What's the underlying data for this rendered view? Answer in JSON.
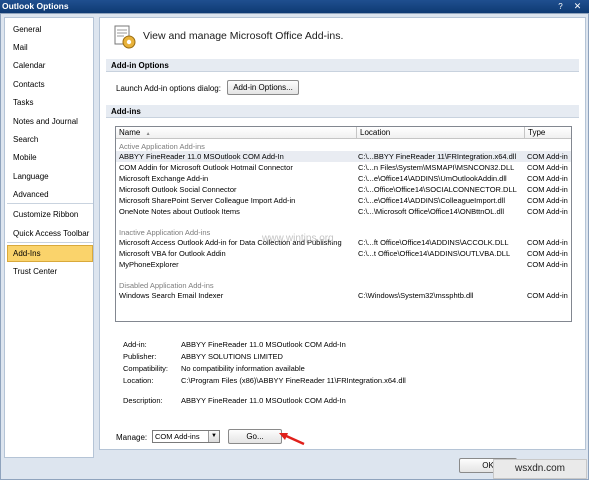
{
  "window": {
    "title": "Outlook Options",
    "help_glyph": "?",
    "close_glyph": "✕"
  },
  "nav": {
    "items": [
      {
        "label": "General"
      },
      {
        "label": "Mail"
      },
      {
        "label": "Calendar"
      },
      {
        "label": "Contacts"
      },
      {
        "label": "Tasks"
      },
      {
        "label": "Notes and Journal"
      },
      {
        "label": "Search"
      },
      {
        "label": "Mobile"
      },
      {
        "label": "Language"
      },
      {
        "label": "Advanced"
      },
      {
        "label": "Customize Ribbon"
      },
      {
        "label": "Quick Access Toolbar"
      },
      {
        "label": "Add-Ins",
        "active": true
      },
      {
        "label": "Trust Center"
      }
    ]
  },
  "header": {
    "title": "View and manage Microsoft Office Add-ins."
  },
  "addin_options": {
    "section_title": "Add-in Options",
    "launch_label": "Launch Add-in options dialog:",
    "button_label": "Add-in Options..."
  },
  "addins": {
    "section_title": "Add-ins",
    "columns": {
      "name": "Name",
      "sort_glyph": "▲",
      "location": "Location",
      "type": "Type"
    },
    "groups": [
      {
        "title": "Active Application Add-ins",
        "rows": [
          {
            "name": "ABBYY FineReader 11.0 MSOutlook COM Add-In",
            "location": "C:\\...BBYY FineReader 11\\FRIntegration.x64.dll",
            "type": "COM Add-in",
            "selected": true
          },
          {
            "name": "COM Addin for Microsoft Outlook Hotmail Connector",
            "location": "C:\\...n Files\\System\\MSMAPI\\MSNCON32.DLL",
            "type": "COM Add-in"
          },
          {
            "name": "Microsoft Exchange Add-in",
            "location": "C:\\...e\\Office14\\ADDINS\\UmOutlookAddin.dll",
            "type": "COM Add-in"
          },
          {
            "name": "Microsoft Outlook Social Connector",
            "location": "C:\\...Office\\Office14\\SOCIALCONNECTOR.DLL",
            "type": "COM Add-in"
          },
          {
            "name": "Microsoft SharePoint Server Colleague Import Add-in",
            "location": "C:\\...e\\Office14\\ADDINS\\ColleagueImport.dll",
            "type": "COM Add-in"
          },
          {
            "name": "OneNote Notes about Outlook Items",
            "location": "C:\\...\\Microsoft Office\\Office14\\ONBttnOL.dll",
            "type": "COM Add-in"
          }
        ]
      },
      {
        "title": "Inactive Application Add-ins",
        "rows": [
          {
            "name": "Microsoft Access Outlook Add-in for Data Collection and Publishing",
            "location": "C:\\...ft Office\\Office14\\ADDINS\\ACCOLK.DLL",
            "type": "COM Add-in"
          },
          {
            "name": "Microsoft VBA for Outlook Addin",
            "location": "C:\\...t Office\\Office14\\ADDINS\\OUTLVBA.DLL",
            "type": "COM Add-in"
          },
          {
            "name": "MyPhoneExplorer",
            "location": "",
            "type": "COM Add-in"
          }
        ]
      },
      {
        "title": "Disabled Application Add-ins",
        "rows": [
          {
            "name": "Windows Search Email Indexer",
            "location": "C:\\Windows\\System32\\mssphtb.dll",
            "type": "COM Add-in"
          }
        ]
      }
    ],
    "watermark": "www.wintips.org"
  },
  "details": {
    "addin_label": "Add-in:",
    "addin_value": "ABBYY FineReader 11.0 MSOutlook COM Add-In",
    "publisher_label": "Publisher:",
    "publisher_value": "ABBYY SOLUTIONS LIMITED",
    "compat_label": "Compatibility:",
    "compat_value": "No compatibility information available",
    "location_label": "Location:",
    "location_value": "C:\\Program Files (x86)\\ABBYY FineReader 11\\FRIntegration.x64.dll",
    "desc_label": "Description:",
    "desc_value": "ABBYY FineReader 11.0 MSOutlook COM Add-In"
  },
  "manage": {
    "label": "Manage:",
    "selected": "COM Add-ins",
    "go_label": "Go..."
  },
  "footer": {
    "ok_label": "OK"
  },
  "logo": {
    "text": "wsxdn.com"
  },
  "colors": {
    "arrow": "#e0201b",
    "accent_selected": "#fad36b"
  }
}
